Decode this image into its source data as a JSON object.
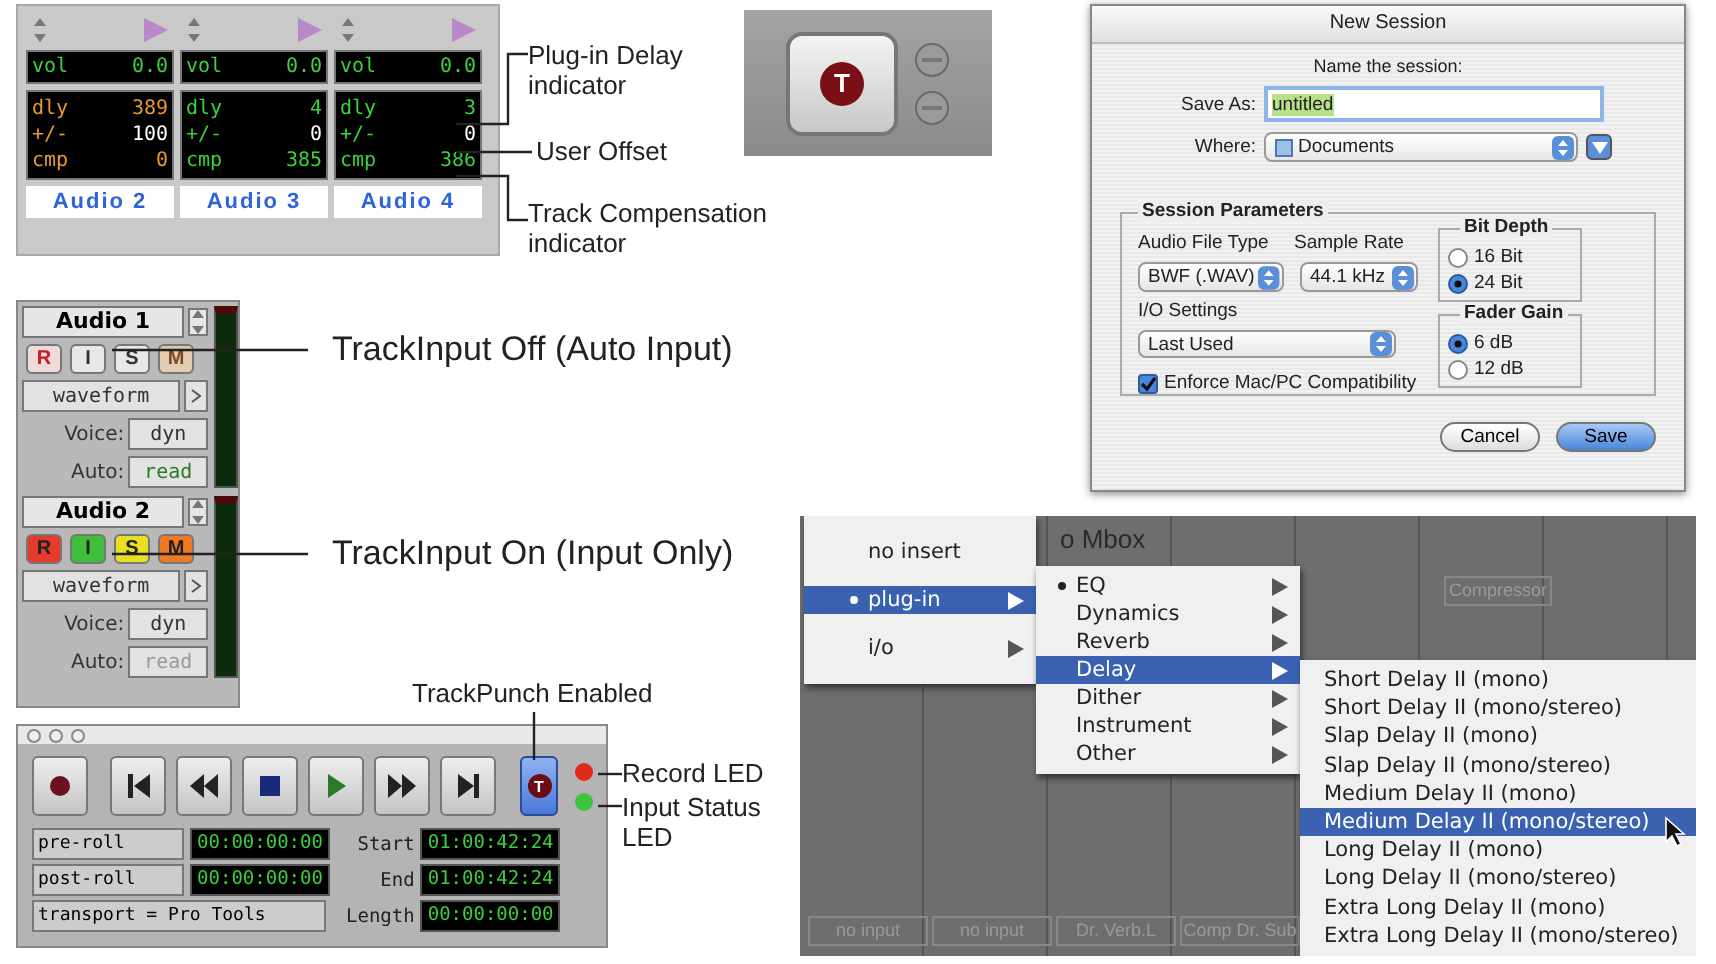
{
  "delay_panel": {
    "tracks": [
      {
        "name": "Audio 2",
        "vol_label": "vol",
        "vol": "0.0",
        "rows": [
          {
            "label": "dly",
            "value": "389"
          },
          {
            "label": "+/-",
            "value": "100"
          },
          {
            "label": "cmp",
            "value": "0"
          }
        ],
        "highlight": true
      },
      {
        "name": "Audio 3",
        "vol_label": "vol",
        "vol": "0.0",
        "rows": [
          {
            "label": "dly",
            "value": "4"
          },
          {
            "label": "+/-",
            "value": "0"
          },
          {
            "label": "cmp",
            "value": "385"
          }
        ],
        "highlight": false
      },
      {
        "name": "Audio 4",
        "vol_label": "vol",
        "vol": "0.0",
        "rows": [
          {
            "label": "dly",
            "value": "3"
          },
          {
            "label": "+/-",
            "value": "0"
          },
          {
            "label": "cmp",
            "value": "386"
          }
        ],
        "highlight": false
      }
    ],
    "callouts": [
      "Plug-in Delay indicator",
      "User Offset",
      "Track Compensation indicator"
    ]
  },
  "closeup": {
    "label": "T"
  },
  "track_input": {
    "tracks": [
      {
        "name": "Audio 1",
        "buttons": [
          {
            "label": "R",
            "kind": "record",
            "on": false
          },
          {
            "label": "I",
            "kind": "input",
            "on": false
          },
          {
            "label": "S",
            "kind": "solo",
            "on": false
          },
          {
            "label": "M",
            "kind": "mute",
            "on": false
          }
        ],
        "view": "waveform",
        "voice_label": "Voice:",
        "voice": "dyn",
        "auto_label": "Auto:",
        "auto": "read",
        "auto_enabled": true
      },
      {
        "name": "Audio 2",
        "buttons": [
          {
            "label": "R",
            "kind": "record",
            "on": true
          },
          {
            "label": "I",
            "kind": "input",
            "on": true
          },
          {
            "label": "S",
            "kind": "solo",
            "on": true
          },
          {
            "label": "M",
            "kind": "mute",
            "on": true
          }
        ],
        "view": "waveform",
        "voice_label": "Voice:",
        "voice": "dyn",
        "auto_label": "Auto:",
        "auto": "read",
        "auto_enabled": false
      }
    ],
    "callouts": [
      "TrackInput Off (Auto Input)",
      "TrackInput On (Input Only)"
    ]
  },
  "transport": {
    "trackpunch": {
      "label": "T",
      "selected": true
    },
    "leds": [
      {
        "color": "#e02a1a"
      },
      {
        "color": "#3cc43c"
      }
    ],
    "rolls": [
      {
        "label": "pre-roll",
        "value": "00:00:00:00"
      },
      {
        "label": "post-roll",
        "value": "00:00:00:00"
      }
    ],
    "mode": "transport = Pro Tools",
    "counters": [
      {
        "label": "Start",
        "value": "01:00:42:24"
      },
      {
        "label": "End",
        "value": "01:00:42:24"
      },
      {
        "label": "Length",
        "value": "00:00:00:00"
      }
    ],
    "callouts": [
      "TrackPunch Enabled",
      "Record LED",
      "Input Status LED"
    ]
  },
  "new_session": {
    "title": "New Session",
    "prompt": "Name the session:",
    "save_as_label": "Save As:",
    "save_as": "untitled",
    "where_label": "Where:",
    "where": "Documents",
    "group_title": "Session Parameters",
    "file_type_label": "Audio File Type",
    "file_type": "BWF (.WAV)",
    "sample_rate_label": "Sample Rate",
    "sample_rate": "44.1 kHz",
    "io_label": "I/O Settings",
    "io": "Last Used",
    "compat": {
      "label": "Enforce Mac/PC Compatibility",
      "checked": true
    },
    "bit_depth": {
      "title": "Bit Depth",
      "options": [
        {
          "label": "16 Bit",
          "selected": false
        },
        {
          "label": "24 Bit",
          "selected": true
        }
      ]
    },
    "fader_gain": {
      "title": "Fader Gain",
      "options": [
        {
          "label": "6 dB",
          "selected": true
        },
        {
          "label": "12 dB",
          "selected": false
        }
      ]
    },
    "buttons": [
      {
        "label": "Cancel",
        "default": false
      },
      {
        "label": "Save",
        "default": true
      }
    ]
  },
  "plugin_menu": {
    "background_title": "o Mbox",
    "background_insert": "Compressor",
    "input_slots": [
      "no input",
      "no input",
      "Dr. Verb.L",
      "Comp Dr. Sub"
    ],
    "menu": [
      {
        "label": "no insert",
        "selected": false,
        "checked": false,
        "submenu": false
      },
      {
        "label": "plug-in",
        "selected": true,
        "checked": true,
        "submenu": true
      },
      {
        "label": "i/o",
        "selected": false,
        "checked": false,
        "submenu": true
      }
    ],
    "categories": [
      {
        "label": "EQ",
        "selected": false,
        "checked": true
      },
      {
        "label": "Dynamics",
        "selected": false,
        "checked": false
      },
      {
        "label": "Reverb",
        "selected": false,
        "checked": false
      },
      {
        "label": "Delay",
        "selected": true,
        "checked": false
      },
      {
        "label": "Dither",
        "selected": false,
        "checked": false
      },
      {
        "label": "Instrument",
        "selected": false,
        "checked": false
      },
      {
        "label": "Other",
        "selected": false,
        "checked": false
      }
    ],
    "plugins": [
      {
        "label": "Short Delay II (mono)",
        "selected": false
      },
      {
        "label": "Short Delay II (mono/stereo)",
        "selected": false
      },
      {
        "label": "Slap Delay II (mono)",
        "selected": false
      },
      {
        "label": "Slap Delay II (mono/stereo)",
        "selected": false
      },
      {
        "label": "Medium Delay II (mono)",
        "selected": false
      },
      {
        "label": "Medium Delay II (mono/stereo)",
        "selected": true
      },
      {
        "label": "Long Delay II (mono)",
        "selected": false
      },
      {
        "label": "Long Delay II (mono/stereo)",
        "selected": false
      },
      {
        "label": "Extra Long Delay II (mono)",
        "selected": false
      },
      {
        "label": "Extra Long Delay II (mono/stereo)",
        "selected": false
      }
    ]
  }
}
